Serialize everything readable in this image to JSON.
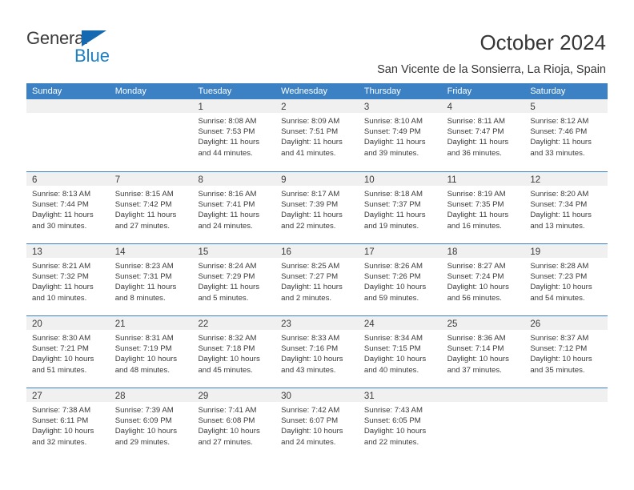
{
  "brand": {
    "name_top": "General",
    "name_bottom": "Blue",
    "accent_color": "#1b7fc4",
    "triangle_color": "#1569b0"
  },
  "header": {
    "title": "October 2024",
    "subtitle": "San Vicente de la Sonsierra, La Rioja, Spain"
  },
  "calendar": {
    "header_bg": "#3b81c4",
    "header_text_color": "#ffffff",
    "daynum_band_bg": "#f0f0f0",
    "weekday_headers": [
      "Sunday",
      "Monday",
      "Tuesday",
      "Wednesday",
      "Thursday",
      "Friday",
      "Saturday"
    ],
    "weeks": [
      [
        {
          "day": "",
          "sunrise": "",
          "sunset": "",
          "daylight_1": "",
          "daylight_2": ""
        },
        {
          "day": "",
          "sunrise": "",
          "sunset": "",
          "daylight_1": "",
          "daylight_2": ""
        },
        {
          "day": "1",
          "sunrise": "Sunrise: 8:08 AM",
          "sunset": "Sunset: 7:53 PM",
          "daylight_1": "Daylight: 11 hours",
          "daylight_2": "and 44 minutes."
        },
        {
          "day": "2",
          "sunrise": "Sunrise: 8:09 AM",
          "sunset": "Sunset: 7:51 PM",
          "daylight_1": "Daylight: 11 hours",
          "daylight_2": "and 41 minutes."
        },
        {
          "day": "3",
          "sunrise": "Sunrise: 8:10 AM",
          "sunset": "Sunset: 7:49 PM",
          "daylight_1": "Daylight: 11 hours",
          "daylight_2": "and 39 minutes."
        },
        {
          "day": "4",
          "sunrise": "Sunrise: 8:11 AM",
          "sunset": "Sunset: 7:47 PM",
          "daylight_1": "Daylight: 11 hours",
          "daylight_2": "and 36 minutes."
        },
        {
          "day": "5",
          "sunrise": "Sunrise: 8:12 AM",
          "sunset": "Sunset: 7:46 PM",
          "daylight_1": "Daylight: 11 hours",
          "daylight_2": "and 33 minutes."
        }
      ],
      [
        {
          "day": "6",
          "sunrise": "Sunrise: 8:13 AM",
          "sunset": "Sunset: 7:44 PM",
          "daylight_1": "Daylight: 11 hours",
          "daylight_2": "and 30 minutes."
        },
        {
          "day": "7",
          "sunrise": "Sunrise: 8:15 AM",
          "sunset": "Sunset: 7:42 PM",
          "daylight_1": "Daylight: 11 hours",
          "daylight_2": "and 27 minutes."
        },
        {
          "day": "8",
          "sunrise": "Sunrise: 8:16 AM",
          "sunset": "Sunset: 7:41 PM",
          "daylight_1": "Daylight: 11 hours",
          "daylight_2": "and 24 minutes."
        },
        {
          "day": "9",
          "sunrise": "Sunrise: 8:17 AM",
          "sunset": "Sunset: 7:39 PM",
          "daylight_1": "Daylight: 11 hours",
          "daylight_2": "and 22 minutes."
        },
        {
          "day": "10",
          "sunrise": "Sunrise: 8:18 AM",
          "sunset": "Sunset: 7:37 PM",
          "daylight_1": "Daylight: 11 hours",
          "daylight_2": "and 19 minutes."
        },
        {
          "day": "11",
          "sunrise": "Sunrise: 8:19 AM",
          "sunset": "Sunset: 7:35 PM",
          "daylight_1": "Daylight: 11 hours",
          "daylight_2": "and 16 minutes."
        },
        {
          "day": "12",
          "sunrise": "Sunrise: 8:20 AM",
          "sunset": "Sunset: 7:34 PM",
          "daylight_1": "Daylight: 11 hours",
          "daylight_2": "and 13 minutes."
        }
      ],
      [
        {
          "day": "13",
          "sunrise": "Sunrise: 8:21 AM",
          "sunset": "Sunset: 7:32 PM",
          "daylight_1": "Daylight: 11 hours",
          "daylight_2": "and 10 minutes."
        },
        {
          "day": "14",
          "sunrise": "Sunrise: 8:23 AM",
          "sunset": "Sunset: 7:31 PM",
          "daylight_1": "Daylight: 11 hours",
          "daylight_2": "and 8 minutes."
        },
        {
          "day": "15",
          "sunrise": "Sunrise: 8:24 AM",
          "sunset": "Sunset: 7:29 PM",
          "daylight_1": "Daylight: 11 hours",
          "daylight_2": "and 5 minutes."
        },
        {
          "day": "16",
          "sunrise": "Sunrise: 8:25 AM",
          "sunset": "Sunset: 7:27 PM",
          "daylight_1": "Daylight: 11 hours",
          "daylight_2": "and 2 minutes."
        },
        {
          "day": "17",
          "sunrise": "Sunrise: 8:26 AM",
          "sunset": "Sunset: 7:26 PM",
          "daylight_1": "Daylight: 10 hours",
          "daylight_2": "and 59 minutes."
        },
        {
          "day": "18",
          "sunrise": "Sunrise: 8:27 AM",
          "sunset": "Sunset: 7:24 PM",
          "daylight_1": "Daylight: 10 hours",
          "daylight_2": "and 56 minutes."
        },
        {
          "day": "19",
          "sunrise": "Sunrise: 8:28 AM",
          "sunset": "Sunset: 7:23 PM",
          "daylight_1": "Daylight: 10 hours",
          "daylight_2": "and 54 minutes."
        }
      ],
      [
        {
          "day": "20",
          "sunrise": "Sunrise: 8:30 AM",
          "sunset": "Sunset: 7:21 PM",
          "daylight_1": "Daylight: 10 hours",
          "daylight_2": "and 51 minutes."
        },
        {
          "day": "21",
          "sunrise": "Sunrise: 8:31 AM",
          "sunset": "Sunset: 7:19 PM",
          "daylight_1": "Daylight: 10 hours",
          "daylight_2": "and 48 minutes."
        },
        {
          "day": "22",
          "sunrise": "Sunrise: 8:32 AM",
          "sunset": "Sunset: 7:18 PM",
          "daylight_1": "Daylight: 10 hours",
          "daylight_2": "and 45 minutes."
        },
        {
          "day": "23",
          "sunrise": "Sunrise: 8:33 AM",
          "sunset": "Sunset: 7:16 PM",
          "daylight_1": "Daylight: 10 hours",
          "daylight_2": "and 43 minutes."
        },
        {
          "day": "24",
          "sunrise": "Sunrise: 8:34 AM",
          "sunset": "Sunset: 7:15 PM",
          "daylight_1": "Daylight: 10 hours",
          "daylight_2": "and 40 minutes."
        },
        {
          "day": "25",
          "sunrise": "Sunrise: 8:36 AM",
          "sunset": "Sunset: 7:14 PM",
          "daylight_1": "Daylight: 10 hours",
          "daylight_2": "and 37 minutes."
        },
        {
          "day": "26",
          "sunrise": "Sunrise: 8:37 AM",
          "sunset": "Sunset: 7:12 PM",
          "daylight_1": "Daylight: 10 hours",
          "daylight_2": "and 35 minutes."
        }
      ],
      [
        {
          "day": "27",
          "sunrise": "Sunrise: 7:38 AM",
          "sunset": "Sunset: 6:11 PM",
          "daylight_1": "Daylight: 10 hours",
          "daylight_2": "and 32 minutes."
        },
        {
          "day": "28",
          "sunrise": "Sunrise: 7:39 AM",
          "sunset": "Sunset: 6:09 PM",
          "daylight_1": "Daylight: 10 hours",
          "daylight_2": "and 29 minutes."
        },
        {
          "day": "29",
          "sunrise": "Sunrise: 7:41 AM",
          "sunset": "Sunset: 6:08 PM",
          "daylight_1": "Daylight: 10 hours",
          "daylight_2": "and 27 minutes."
        },
        {
          "day": "30",
          "sunrise": "Sunrise: 7:42 AM",
          "sunset": "Sunset: 6:07 PM",
          "daylight_1": "Daylight: 10 hours",
          "daylight_2": "and 24 minutes."
        },
        {
          "day": "31",
          "sunrise": "Sunrise: 7:43 AM",
          "sunset": "Sunset: 6:05 PM",
          "daylight_1": "Daylight: 10 hours",
          "daylight_2": "and 22 minutes."
        },
        {
          "day": "",
          "sunrise": "",
          "sunset": "",
          "daylight_1": "",
          "daylight_2": ""
        },
        {
          "day": "",
          "sunrise": "",
          "sunset": "",
          "daylight_1": "",
          "daylight_2": ""
        }
      ]
    ]
  }
}
